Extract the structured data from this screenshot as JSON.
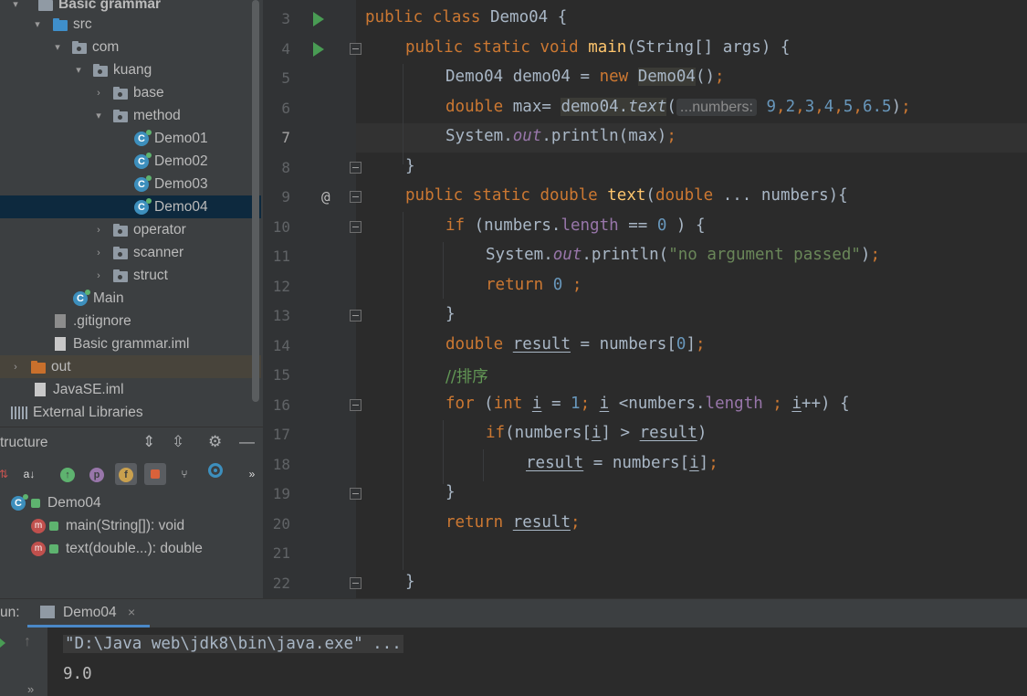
{
  "project_tree": {
    "items": [
      {
        "label": "Basic grammar",
        "arrow": "▾",
        "icon": "module-folder"
      },
      {
        "label": "src",
        "arrow": "▾",
        "icon": "source-folder"
      },
      {
        "label": "com",
        "arrow": "▾",
        "icon": "package"
      },
      {
        "label": "kuang",
        "arrow": "▾",
        "icon": "package"
      },
      {
        "label": "base",
        "arrow": "›",
        "icon": "package"
      },
      {
        "label": "method",
        "arrow": "▾",
        "icon": "package"
      },
      {
        "label": "Demo01",
        "arrow": "",
        "icon": "class"
      },
      {
        "label": "Demo02",
        "arrow": "",
        "icon": "class"
      },
      {
        "label": "Demo03",
        "arrow": "",
        "icon": "class"
      },
      {
        "label": "Demo04",
        "arrow": "",
        "icon": "class"
      },
      {
        "label": "operator",
        "arrow": "›",
        "icon": "package"
      },
      {
        "label": "scanner",
        "arrow": "›",
        "icon": "package"
      },
      {
        "label": "struct",
        "arrow": "›",
        "icon": "package"
      },
      {
        "label": "Main",
        "arrow": "",
        "icon": "class"
      },
      {
        "label": ".gitignore",
        "arrow": "",
        "icon": "file"
      },
      {
        "label": "Basic grammar.iml",
        "arrow": "",
        "icon": "file"
      },
      {
        "label": "out",
        "arrow": "›",
        "icon": "excluded-folder"
      },
      {
        "label": "JavaSE.iml",
        "arrow": "",
        "icon": "file"
      },
      {
        "label": "External Libraries",
        "arrow": "",
        "icon": "library"
      }
    ],
    "selected": "Demo04"
  },
  "structure": {
    "title": "tructure",
    "class_name": "Demo04",
    "members": [
      {
        "label": "main(String[]): void",
        "icon": "method-icon"
      },
      {
        "label": "text(double...): double",
        "icon": "method-icon"
      }
    ],
    "tool_letters": {
      "p": "p",
      "f": "f",
      "more": "»",
      "sort": "a↓"
    }
  },
  "editor": {
    "line_numbers": [
      "3",
      "4",
      "5",
      "6",
      "7",
      "8",
      "9",
      "10",
      "11",
      "12",
      "13",
      "14",
      "15",
      "16",
      "17",
      "18",
      "19",
      "20",
      "21",
      "22"
    ],
    "current_line": "7",
    "gutter_at": "@",
    "code": {
      "l3": {
        "kw": "public class ",
        "name": "Demo04",
        "rest": " {"
      },
      "l4": {
        "kw": "public static void ",
        "fn": "main",
        "rest": "(String[] args) {"
      },
      "l5": {
        "a": "Demo04 demo04 = ",
        "kw": "new ",
        "cls": "Demo04",
        "b": "()",
        "semi": ";"
      },
      "l6": {
        "kw": "double ",
        "a": "max= ",
        "obj": "demo04.",
        "call": "text",
        "paren": "(",
        "hint": "...numbers:",
        "args": [
          "9",
          "2",
          "3",
          "4",
          "5",
          "6.5"
        ],
        "comma": ",",
        "end": ")",
        "semi": ";"
      },
      "l7": {
        "a": "System.",
        "fld": "out",
        "b": ".println(max)",
        "semi": ";"
      },
      "l8": {
        "a": "}"
      },
      "l9": {
        "kw": "public static double ",
        "fn": "text",
        "a": "(",
        "kw2": "double",
        "b": " ... numbers){"
      },
      "l10": {
        "kw": "if ",
        "a": "(numbers.",
        "fld": "length",
        "b": " == ",
        "num": "0",
        "c": " ) {"
      },
      "l11": {
        "a": "System.",
        "fld": "out",
        "b": ".println(",
        "str": "\"no argument passed\"",
        "c": ")",
        "semi": ";"
      },
      "l12": {
        "kw": "return ",
        "num": "0",
        "semi": " ;"
      },
      "l13": {
        "a": "}"
      },
      "l14": {
        "kw": "double ",
        "var": "result",
        "a": " = numbers[",
        "num": "0",
        "b": "]",
        "semi": ";"
      },
      "l15": {
        "cmt": "//排序"
      },
      "l16": {
        "kw": "for ",
        "a": "(",
        "kw2": "int ",
        "i1": "i",
        "b": " = ",
        "num": "1",
        "semi1": "; ",
        "i2": "i",
        "c": " <numbers.",
        "fld": "length",
        "semi2": " ; ",
        "i3": "i",
        "d": "++) {"
      },
      "l17": {
        "kw": "if",
        "a": "(numbers[",
        "i": "i",
        "b": "] > ",
        "var": "result",
        "c": ")"
      },
      "l18": {
        "var": "result",
        "a": " = numbers[",
        "i": "i",
        "b": "]",
        "semi": ";"
      },
      "l19": {
        "a": "}"
      },
      "l20": {
        "kw": "return ",
        "var": "result",
        "semi": ";"
      },
      "l22": {
        "a": "}"
      }
    }
  },
  "run_panel": {
    "label": "un:",
    "tab": "Demo04",
    "close": "×",
    "output": [
      "\"D:\\Java web\\jdk8\\bin\\java.exe\" ...",
      "9.0"
    ]
  },
  "colors": {
    "keyword": "#cc7832",
    "function": "#ffc66d",
    "number": "#6897bb",
    "string": "#6a8759",
    "field": "#9876aa",
    "selection": "#0d293e"
  }
}
